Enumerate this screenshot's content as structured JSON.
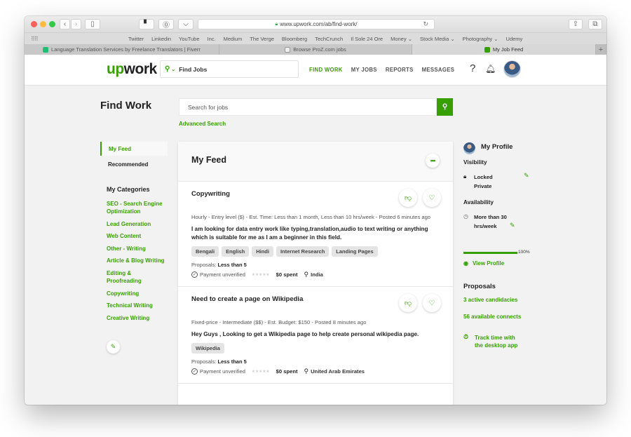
{
  "browser": {
    "url": "www.upwork.com/ab/find-work/",
    "bookmarks": [
      "Twitter",
      "Linkedin",
      "YouTube",
      "Inc.",
      "Medium",
      "The Verge",
      "Bloomberg",
      "TechCrunch",
      "Il Sole 24 Ore",
      "Money ⌄",
      "Stock Media ⌄",
      "Photography ⌄",
      "Udemy"
    ],
    "tabs": [
      {
        "label": "Language Translation Services by Freelance Translators | Fiverr",
        "active": false
      },
      {
        "label": "Browse ProZ.com jobs",
        "active": false
      },
      {
        "label": "My Job Feed",
        "active": true
      }
    ],
    "new_tab": "+"
  },
  "header": {
    "logo_up": "up",
    "logo_work": "work",
    "search_placeholder": "Find Jobs",
    "nav": [
      "FIND WORK",
      "MY JOBS",
      "REPORTS",
      "MESSAGES"
    ],
    "active_nav": "FIND WORK",
    "help": "?",
    "bell": "🔔"
  },
  "page": {
    "title": "Find Work",
    "search_placeholder": "Search for jobs",
    "advanced_search": "Advanced Search"
  },
  "sidebar": {
    "nav": [
      {
        "label": "My Feed",
        "active": true
      },
      {
        "label": "Recommended",
        "active": false
      }
    ],
    "categories_title": "My Categories",
    "categories": [
      "SEO - Search Engine Optimization",
      "Lead Generation",
      "Web Content",
      "Other - Writing",
      "Article & Blog Writing",
      "Editing & Proofreading",
      "Copywriting",
      "Technical Writing",
      "Creative Writing"
    ]
  },
  "feed": {
    "title": "My Feed",
    "jobs": [
      {
        "title": "Copywriting",
        "meta": "Hourly - Entry level ($) - Est. Time: Less than 1 month, Less than 10 hrs/week - Posted 6 minutes ago",
        "description": "I am looking for data entry work like typing,translation,audio to text writing or anything which is suitable for me as I am a beginner in this field.",
        "skills": [
          "Bengali",
          "English",
          "Hindi",
          "Internet Research",
          "Landing Pages"
        ],
        "proposals_label": "Proposals:",
        "proposals_value": "Less than 5",
        "payment": "Payment unverified",
        "rating": 0,
        "spent": "$0 spent",
        "location": "India"
      },
      {
        "title": "Need to create a page on Wikipedia",
        "meta": "Fixed-price - Intermediate ($$) - Est. Budget: $150 - Posted 8 minutes ago",
        "description": "Hey Guys , Looking to get a Wikipedia page to help create personal wikipedia page.",
        "skills": [
          "Wikipedia"
        ],
        "proposals_label": "Proposals:",
        "proposals_value": "Less than 5",
        "payment": "Payment unverified",
        "rating": 0,
        "spent": "$0 spent",
        "location": "United Arab Emirates"
      }
    ]
  },
  "profile": {
    "title": "My Profile",
    "visibility_label": "Visibility",
    "visibility_value_1": "Locked",
    "visibility_value_2": "Private",
    "availability_label": "Availability",
    "availability_value_1": "More than 30",
    "availability_value_2": "hrs/week",
    "completeness_percent": 100,
    "completeness_label": "100%",
    "view_profile": "View Profile",
    "proposals_title": "Proposals",
    "active_candidacies": "3 active candidacies",
    "available_connects": "56 available connects",
    "track_time_1": "Track time with",
    "track_time_2": "the desktop app"
  },
  "colors": {
    "brand_green": "#37a000"
  }
}
